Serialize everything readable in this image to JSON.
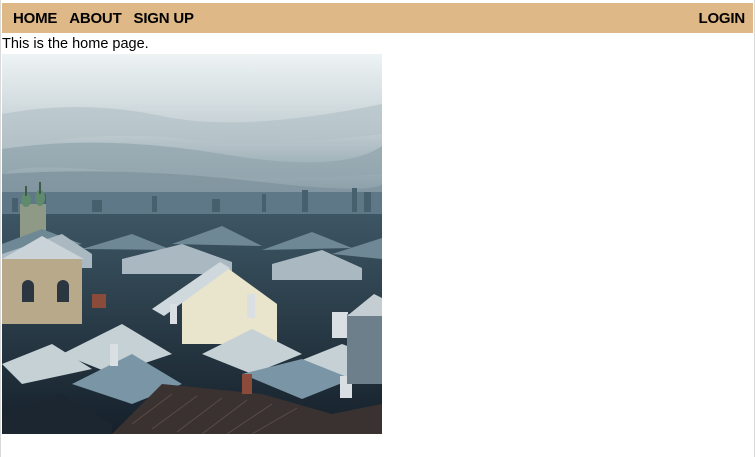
{
  "nav": {
    "left_items": [
      "HOME",
      "ABOUT",
      "SIGN UP"
    ],
    "right_item": "LOGIN",
    "background": "#deb887"
  },
  "page": {
    "intro_text": "This is the home page."
  },
  "image": {
    "subject": "snowy-rooftops-cityscape"
  }
}
